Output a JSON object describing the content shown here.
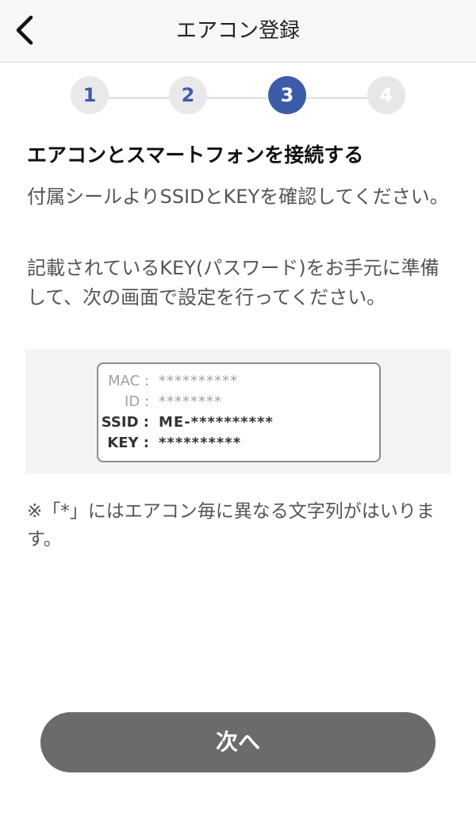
{
  "header": {
    "title": "エアコン登録",
    "back_icon": "chevron-left-icon"
  },
  "stepper": {
    "steps": [
      "1",
      "2",
      "3",
      "4"
    ],
    "current": 3,
    "colors": {
      "active": "#3d5ca8",
      "inactive": "#e9e9e9"
    }
  },
  "main": {
    "heading": "エアコンとスマートフォンを接続する",
    "paragraph1": "付属シールよりSSIDとKEYを確認してください。",
    "paragraph2": "記載されているKEY(パスワード)をお手元に準備して、次の画面で設定を行ってください。",
    "label": {
      "rows": [
        {
          "key": "MAC :",
          "value": "**********"
        },
        {
          "key": "ID :",
          "value": "********"
        },
        {
          "key": "SSID :",
          "value": "ME-**********"
        },
        {
          "key": "KEY :",
          "value": "**********"
        }
      ]
    },
    "note": "※「*」にはエアコン毎に異なる文字列がはいります。"
  },
  "footer": {
    "next_label": "次へ"
  }
}
